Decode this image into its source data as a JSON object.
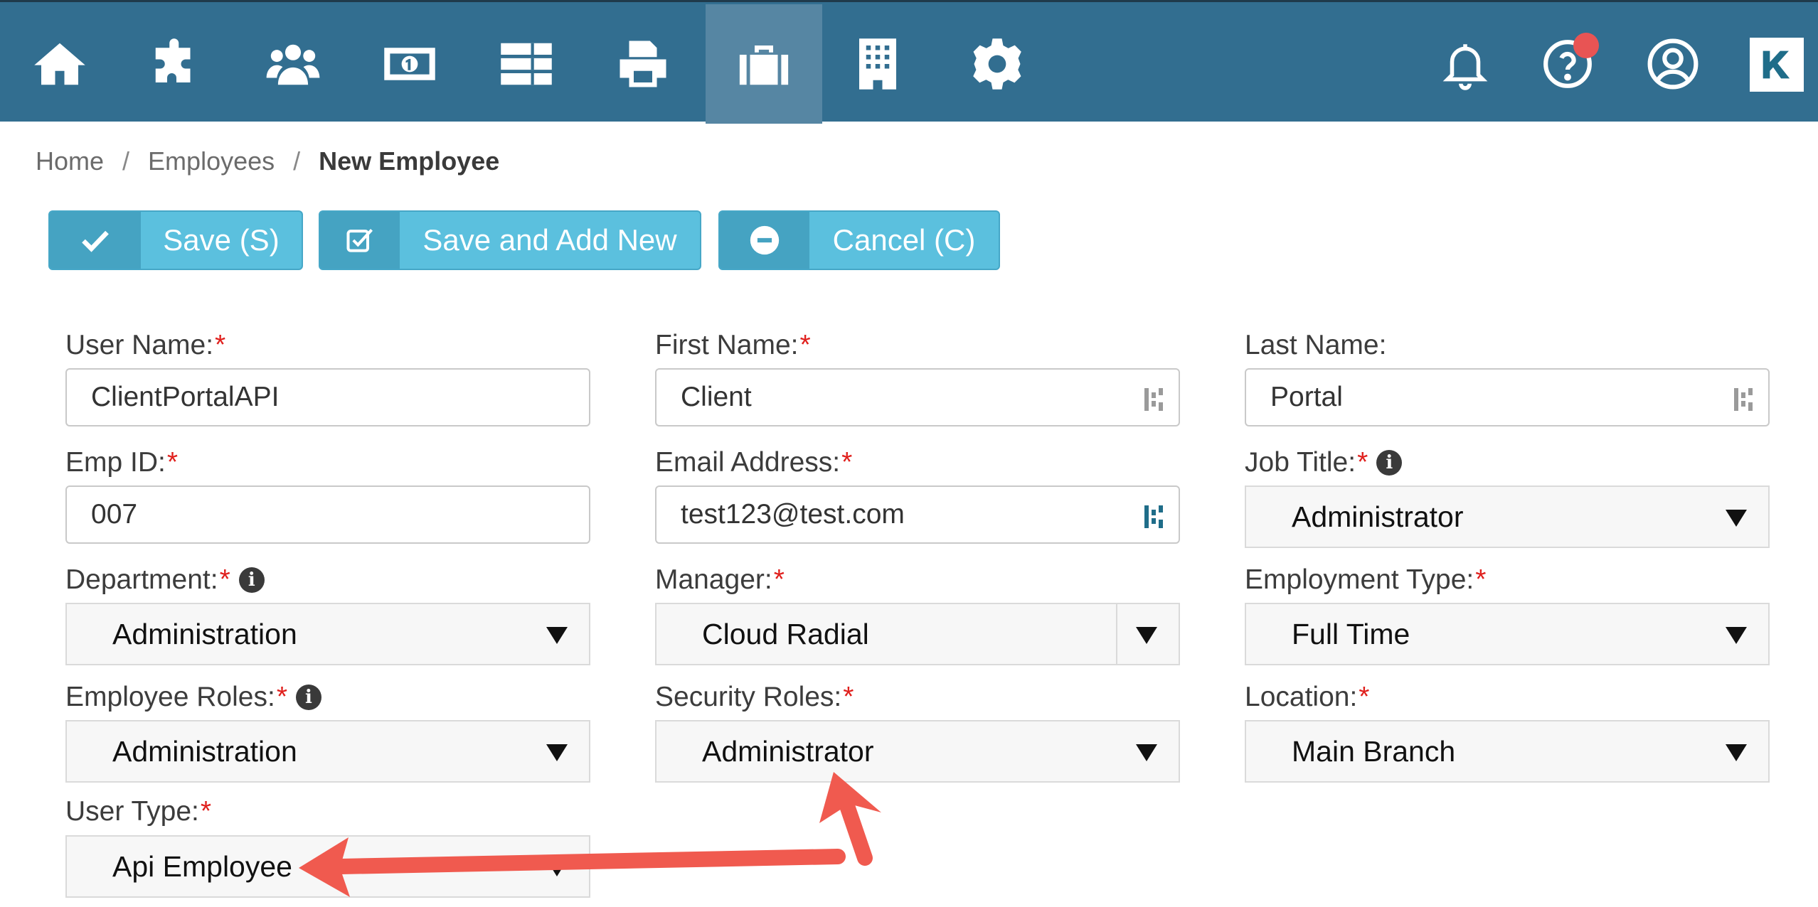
{
  "nav": {
    "items": [
      {
        "name": "home-icon"
      },
      {
        "name": "puzzle-icon"
      },
      {
        "name": "users-icon"
      },
      {
        "name": "money-icon"
      },
      {
        "name": "list-icon"
      },
      {
        "name": "printer-icon"
      },
      {
        "name": "briefcase-icon",
        "active": true
      },
      {
        "name": "building-icon"
      },
      {
        "name": "gear-icon"
      }
    ],
    "right": [
      "bell-icon",
      "help-icon",
      "user-icon",
      "brand-logo"
    ],
    "logo_text": "K"
  },
  "breadcrumb": {
    "home": "Home",
    "separator": "/",
    "employees": "Employees",
    "current": "New Employee"
  },
  "toolbar": {
    "save_label": "Save (S)",
    "save_add_label": "Save and Add New",
    "cancel_label": "Cancel (C)"
  },
  "form": {
    "required_mark": "*",
    "info_glyph": "i",
    "user_name": {
      "label": "User Name:",
      "value": "ClientPortalAPI"
    },
    "first_name": {
      "label": "First Name:",
      "value": "Client"
    },
    "last_name": {
      "label": "Last Name:",
      "value": "Portal"
    },
    "emp_id": {
      "label": "Emp ID:",
      "value": "007"
    },
    "email": {
      "label": "Email Address:",
      "value": "test123@test.com"
    },
    "job_title": {
      "label": "Job Title:",
      "value": "Administrator"
    },
    "department": {
      "label": "Department:",
      "value": "Administration"
    },
    "manager": {
      "label": "Manager:",
      "value": "Cloud Radial"
    },
    "employment_type": {
      "label": "Employment Type:",
      "value": "Full Time"
    },
    "employee_roles": {
      "label": "Employee Roles:",
      "value": "Administration"
    },
    "security_roles": {
      "label": "Security Roles:",
      "value": "Administrator"
    },
    "location": {
      "label": "Location:",
      "value": "Main Branch"
    },
    "user_type": {
      "label": "User Type:",
      "value": "Api Employee"
    }
  },
  "colors": {
    "nav_bg": "#326e90",
    "nav_active": "#5686a3",
    "button_bg": "#5bc0de",
    "button_icon_bg": "#45a3c2",
    "required": "#e0201d",
    "annotation_arrow": "#f05a4f",
    "notification_dot": "#e85454"
  }
}
